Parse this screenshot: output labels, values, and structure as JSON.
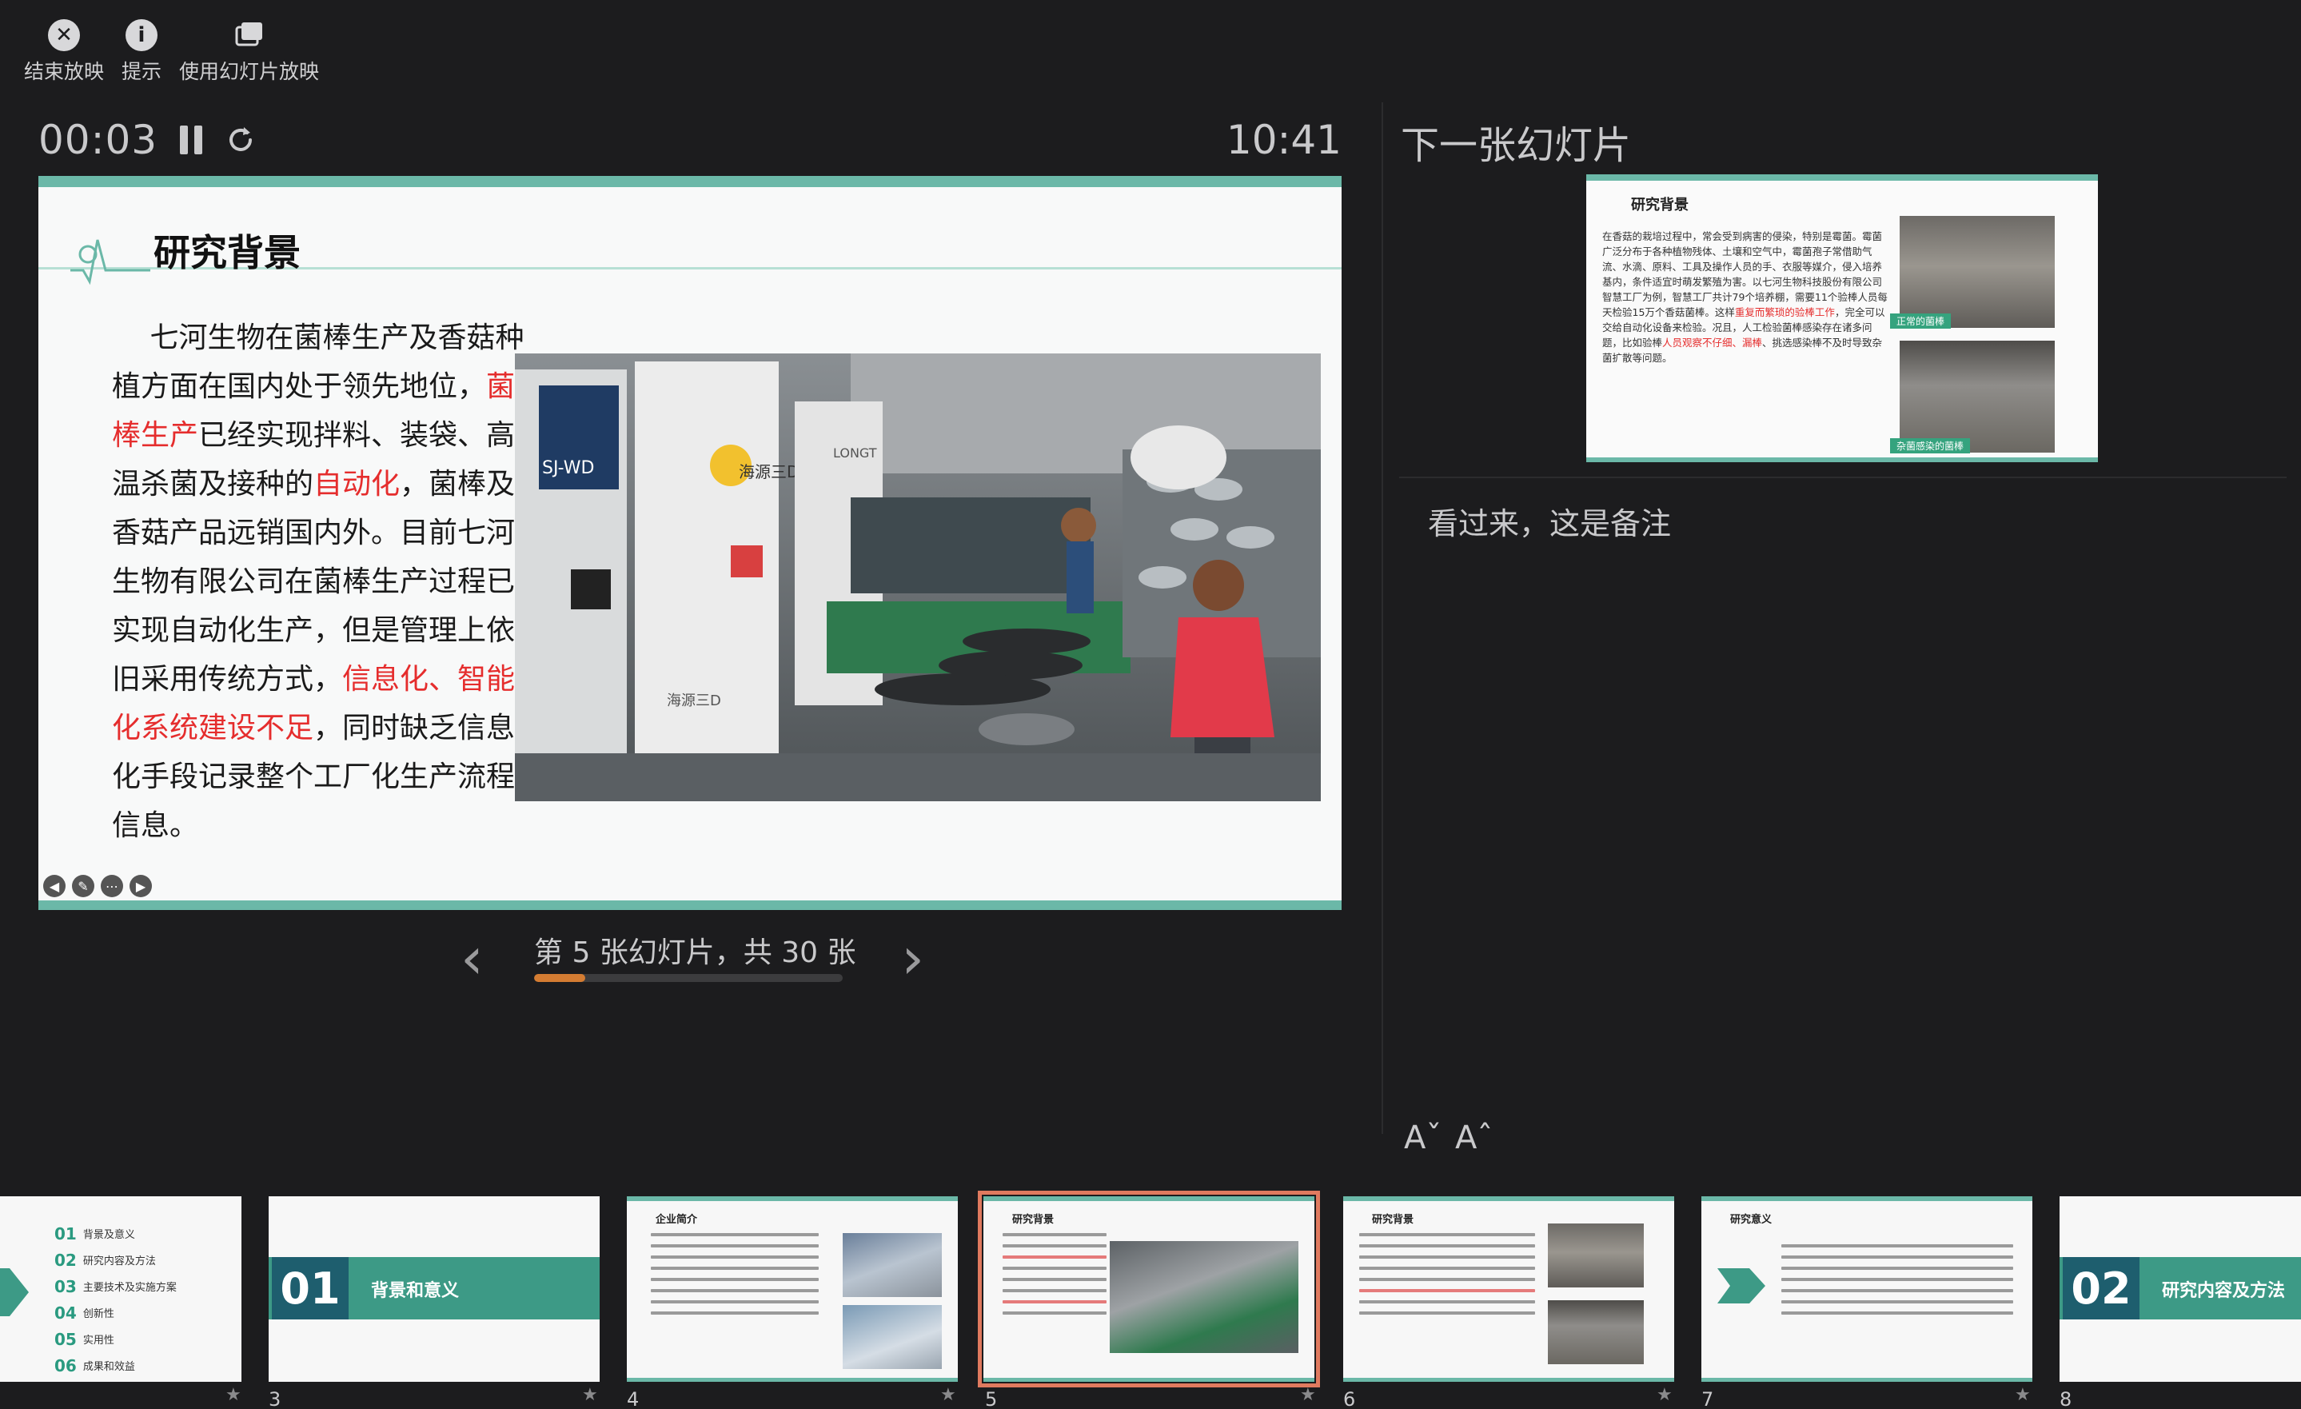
{
  "toolbar": {
    "end_show": "结束放映",
    "hint": "提示",
    "use_slideshow": "使用幻灯片放映"
  },
  "timer": {
    "elapsed": "00:03",
    "clock": "10:41"
  },
  "current_slide": {
    "title": "研究背景",
    "body": [
      {
        "text": "七河生物在菌棒生产及香菇种植方面在国内处于领先地位，",
        "highlight": false
      },
      {
        "text": "菌棒生产",
        "highlight": true
      },
      {
        "text": "已经实现拌料、装袋、高温杀菌及接种的",
        "highlight": false
      },
      {
        "text": "自动化",
        "highlight": true
      },
      {
        "text": "，菌棒及香菇产品远销国内外。目前七河生物有限公司在菌棒生产过程已实现自动化生产，但是管理上依旧采用传统方式，",
        "highlight": false
      },
      {
        "text": "信息化、智能化系统建设不足",
        "highlight": true
      },
      {
        "text": "，同时缺乏信息化手段记录整个工厂化生产流程信息。",
        "highlight": false
      }
    ],
    "photo_signs": {
      "brand_1": "SJ-WD",
      "brand_2": "海源三D",
      "brand_3": "海源三D",
      "brand_4": "LONGT"
    }
  },
  "counter": {
    "text": "第 5 张幻灯片，共 30 张",
    "current": 5,
    "total": 30
  },
  "next_panel": {
    "label": "下一张幻灯片",
    "slide_title": "研究背景",
    "text": [
      {
        "text": "在香菇的栽培过程中，常会受到病害的侵染，特别是霉菌。霉菌广泛分布于各种植物残体、土壤和空气中，霉菌孢子常借助气流、水滴、原料、工具及操作人员的手、衣服等媒介，侵入培养基内，条件适宜时萌发繁殖为害。以七河生物科技股份有限公司智慧工厂为例，智慧工厂共计79个培养棚，需要11个验棒人员每天检验15万个香菇菌棒。这样",
        "highlight": false
      },
      {
        "text": "重复而繁琐的验棒工作",
        "highlight": true
      },
      {
        "text": "，完全可以交给自动化设备来检验。况且，人工检验菌棒感染存在诸多问题，比如验棒",
        "highlight": false
      },
      {
        "text": "人员观察不仔细、漏棒",
        "highlight": true
      },
      {
        "text": "、挑选感染棒不及时导致杂菌扩散等问题。",
        "highlight": false
      }
    ],
    "caption_1": "正常的菌棒",
    "caption_2": "杂菌感染的菌棒",
    "notes": "看过来，这是备注"
  },
  "filmstrip": {
    "slides": [
      {
        "number": "",
        "type": "toc",
        "toc": [
          {
            "num": "01",
            "label": "背景及意义"
          },
          {
            "num": "02",
            "label": "研究内容及方法"
          },
          {
            "num": "03",
            "label": "主要技术及实施方案"
          },
          {
            "num": "04",
            "label": "创新性"
          },
          {
            "num": "05",
            "label": "实用性"
          },
          {
            "num": "06",
            "label": "成果和效益"
          }
        ]
      },
      {
        "number": "3",
        "type": "section",
        "section_num": "01",
        "section_name": "背景和意义"
      },
      {
        "number": "4",
        "type": "content",
        "title": "企业简介"
      },
      {
        "number": "5",
        "type": "content",
        "title": "研究背景",
        "current": true
      },
      {
        "number": "6",
        "type": "content",
        "title": "研究背景"
      },
      {
        "number": "7",
        "type": "content",
        "title": "研究意义"
      },
      {
        "number": "8",
        "type": "section",
        "section_num": "02",
        "section_name": "研究内容及方法"
      }
    ]
  },
  "colors": {
    "accent": "#6bb8a8",
    "highlight": "#e52d2d",
    "progress": "#d47c32",
    "current_outline": "#e07a5f"
  }
}
